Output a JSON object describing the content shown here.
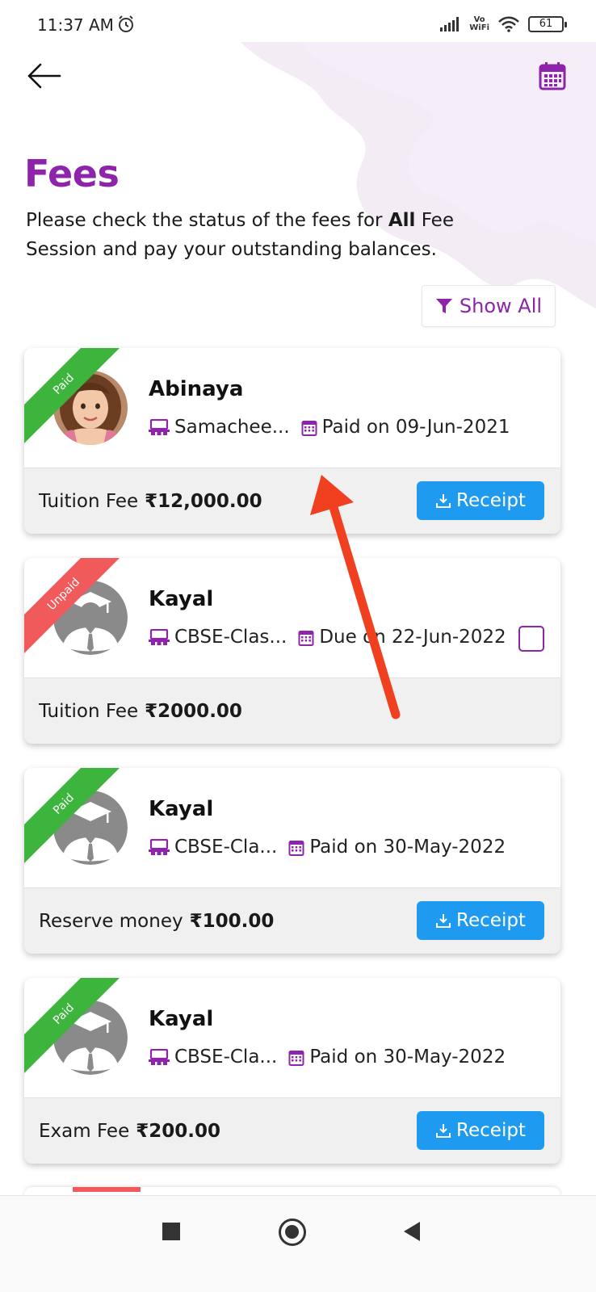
{
  "status_bar": {
    "time": "11:37 AM",
    "vowifi_top": "Vo",
    "vowifi_bottom": "WiFi",
    "battery": "61"
  },
  "header": {
    "title": "Fees",
    "desc_before": "Please check the status of the fees for ",
    "desc_bold": "All",
    "desc_after": " Fee Session and pay your outstanding balances.",
    "filter_label": "Show All"
  },
  "fees": [
    {
      "status": "Paid",
      "name": "Abinaya",
      "class": "Samachee...",
      "date_text": "Paid on 09-Jun-2021",
      "fee_type": "Tuition Fee",
      "amount": "₹12,000.00",
      "action_label": "Receipt"
    },
    {
      "status": "Unpaid",
      "name": "Kayal",
      "class": "CBSE-Clas...",
      "date_text": "Due on 22-Jun-2022",
      "fee_type": "Tuition Fee",
      "amount": "₹2000.00"
    },
    {
      "status": "Paid",
      "name": "Kayal",
      "class": "CBSE-Cla...",
      "date_text": "Paid on 30-May-2022",
      "fee_type": "Reserve money",
      "amount": "₹100.00",
      "action_label": "Receipt"
    },
    {
      "status": "Paid",
      "name": "Kayal",
      "class": "CBSE-Cla...",
      "date_text": "Paid on 30-May-2022",
      "fee_type": "Exam Fee",
      "amount": "₹200.00",
      "action_label": "Receipt"
    }
  ],
  "colors": {
    "accent": "#8e24aa",
    "paid": "#3db53d",
    "unpaid": "#f05a5a",
    "receipt_button": "#1e9bf0",
    "annotation_arrow": "#f0401f"
  }
}
